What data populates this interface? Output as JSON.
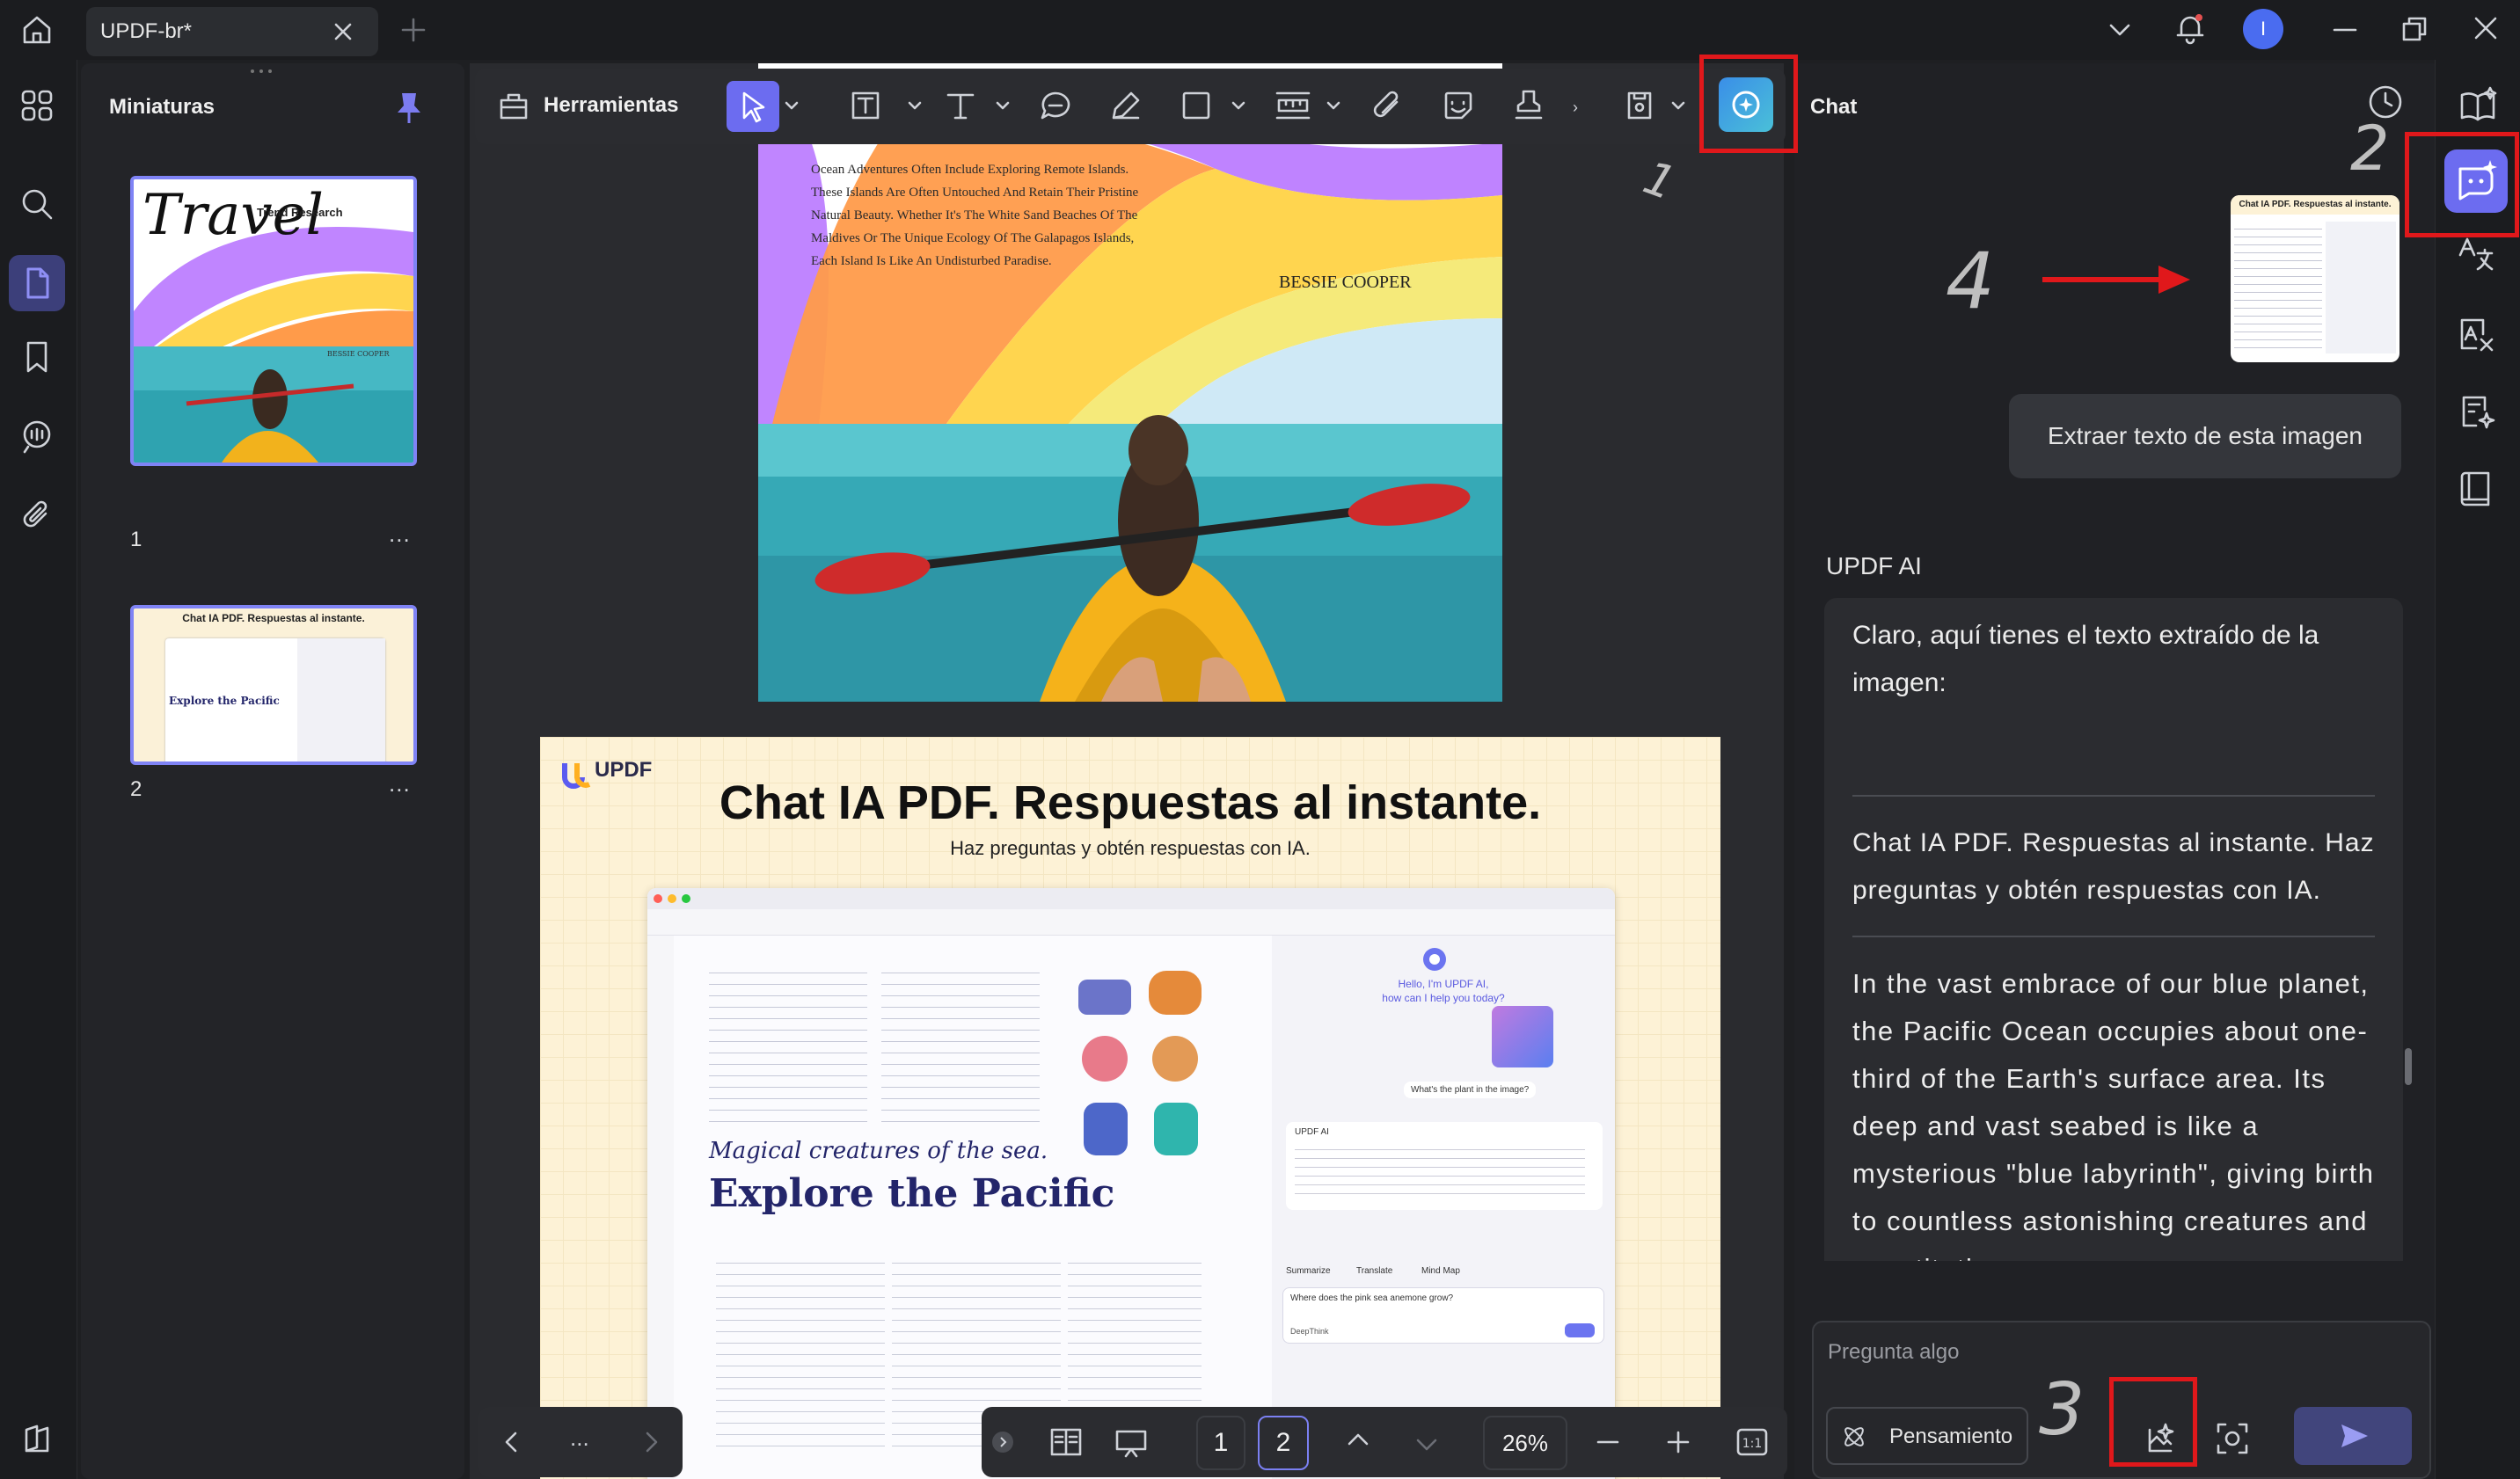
{
  "tab": {
    "title": "UPDF-br*"
  },
  "thumbnails": {
    "panel_title": "Miniaturas",
    "items": [
      {
        "page": "1",
        "more": "...",
        "heading": "Travel",
        "sub": "Trend Research",
        "author": "BESSIE COOPER"
      },
      {
        "page": "2",
        "more": "...",
        "heading": "Chat IA PDF. Respuestas al instante.",
        "sub": "Explore the Pacific"
      }
    ]
  },
  "toolbar": {
    "tools_label": "Herramientas"
  },
  "page1": {
    "body": "Ocean Adventures Often Include Exploring Remote Islands. These Islands Are Often Untouched And Retain Their Pristine Natural Beauty. Whether It's The White Sand Beaches Of The Maldives Or The Unique Ecology Of The Galapagos Islands, Each Island Is Like An Undisturbed Paradise.",
    "author": "BESSIE COOPER"
  },
  "page2": {
    "logo": "UPDF",
    "title": "Chat IA PDF. Respuestas al instante.",
    "subtitle": "Haz preguntas y obtén respuestas con IA.",
    "inner": {
      "italic": "Magical creatures of the sea.",
      "heading": "Explore the Pacific",
      "greeting": "Hello, I'm UPDF AI,",
      "greeting2": "how can I help you today?",
      "question_bubble": "What's the plant in the image?",
      "ai_label": "UPDF AI",
      "chips": [
        "Summarize",
        "Translate",
        "Mind Map"
      ],
      "prompt": "Where does the pink sea anemone grow?",
      "model": "DeepThink"
    }
  },
  "bottom_bar": {
    "more": "...",
    "page_current": "1",
    "page_next": "2",
    "zoom": "26%"
  },
  "chat": {
    "title": "Chat",
    "user_message": "Extraer texto de esta imagen",
    "ai_name": "UPDF AI",
    "ai_intro": "Claro, aquí tienes el texto extraído de la imagen:",
    "ai_block1": "Chat IA PDF. Respuestas al instante. Haz preguntas y obtén respuestas con IA.",
    "ai_block2": "In the vast embrace of our blue planet, the Pacific Ocean occupies about one-third of the Earth's surface area. Its deep and vast seabed is like a mysterious \"blue labyrinth\", giving birth to countless astonishing creatures and constituting a",
    "input_placeholder": "Pregunta algo",
    "thinking_label": "Pensamiento"
  },
  "annotations": {
    "n1": "1",
    "n2": "2",
    "n3": "3",
    "n4": "4",
    "color": "#e0181b"
  },
  "colors": {
    "accent": "#6c6cf0",
    "bg": "#1e1f22",
    "panel": "#202125"
  }
}
